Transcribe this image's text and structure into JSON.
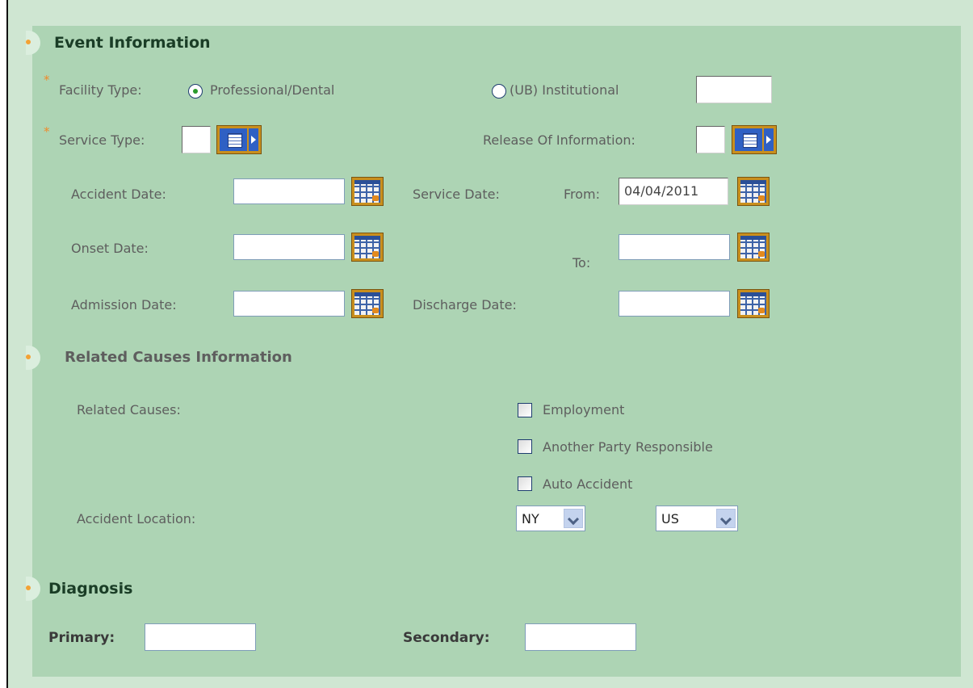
{
  "sections": {
    "event": "Event Information",
    "related": "Related Causes Information",
    "diagnosis": "Diagnosis"
  },
  "required_mark": "*",
  "facility": {
    "label": "Facility Type:",
    "option_professional": "Professional/Dental",
    "option_institutional": "(UB) Institutional",
    "selected": "Professional/Dental",
    "extra_value": ""
  },
  "service_type": {
    "label": "Service Type:",
    "value": ""
  },
  "release_of_information": {
    "label": "Release Of Information:",
    "value": ""
  },
  "dates": {
    "accident_label": "Accident Date:",
    "accident_value": "",
    "onset_label": "Onset Date:",
    "onset_value": "",
    "admission_label": "Admission Date:",
    "admission_value": "",
    "service_label": "Service Date:",
    "from_label": "From:",
    "from_value": "04/04/2011",
    "to_label": "To:",
    "to_value": "",
    "discharge_label": "Discharge Date:",
    "discharge_value": ""
  },
  "related_causes": {
    "label": "Related Causes:",
    "options": [
      "Employment",
      "Another Party Responsible",
      "Auto Accident"
    ],
    "checked": [
      false,
      false,
      false
    ]
  },
  "accident_location": {
    "label": "Accident Location:",
    "state": "NY",
    "country": "US"
  },
  "diagnosis": {
    "primary_label": "Primary:",
    "primary_value": "",
    "secondary_label": "Secondary:",
    "secondary_value": ""
  },
  "colors": {
    "panel": "#add4b4",
    "outer": "#cfe6d2",
    "bullet": "#f3a235",
    "required": "#f08a2a",
    "heading": "#1a3d26"
  },
  "icons": [
    "calendar-icon",
    "lookup-list-icon",
    "chevron-down-icon",
    "section-bullet-icon"
  ]
}
